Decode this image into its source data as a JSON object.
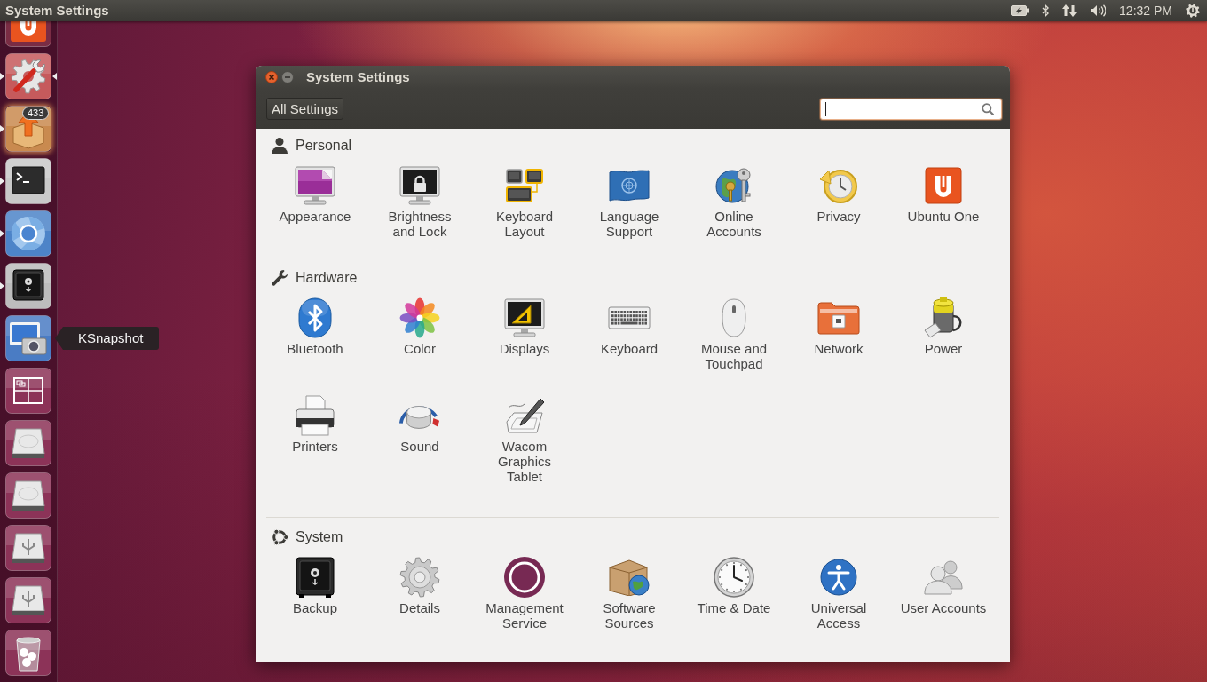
{
  "top_panel": {
    "title": "System Settings",
    "clock": "12:32 PM"
  },
  "launcher": {
    "items": [
      {
        "running": false,
        "focused": false
      },
      {
        "running": true,
        "focused": true
      },
      {
        "running": true,
        "focused": false,
        "badge": "433"
      },
      {
        "running": true,
        "focused": false
      },
      {
        "running": true,
        "focused": false
      },
      {
        "running": true,
        "focused": false
      },
      {
        "running": false,
        "focused": false,
        "tooltip": "KSnapshot"
      },
      {
        "running": false,
        "focused": false
      },
      {
        "running": false,
        "focused": false
      },
      {
        "running": false,
        "focused": false
      },
      {
        "running": false,
        "focused": false
      },
      {
        "running": false,
        "focused": false
      },
      {
        "running": false,
        "focused": false
      }
    ]
  },
  "window": {
    "title": "System Settings",
    "back_button": "All Settings",
    "search": {
      "focused": true
    }
  },
  "sections": [
    {
      "title": "Personal",
      "items": [
        {
          "label": "Appearance"
        },
        {
          "label": "Brightness and Lock"
        },
        {
          "label": "Keyboard Layout"
        },
        {
          "label": "Language Support"
        },
        {
          "label": "Online Accounts"
        },
        {
          "label": "Privacy"
        },
        {
          "label": "Ubuntu One"
        }
      ]
    },
    {
      "title": "Hardware",
      "items": [
        {
          "label": "Bluetooth"
        },
        {
          "label": "Color"
        },
        {
          "label": "Displays"
        },
        {
          "label": "Keyboard"
        },
        {
          "label": "Mouse and Touchpad"
        },
        {
          "label": "Network"
        },
        {
          "label": "Power"
        },
        {
          "label": "Printers"
        },
        {
          "label": "Sound"
        },
        {
          "label": "Wacom Graphics Tablet"
        }
      ]
    },
    {
      "title": "System",
      "items": [
        {
          "label": "Backup"
        },
        {
          "label": "Details"
        },
        {
          "label": "Management Service"
        },
        {
          "label": "Software Sources"
        },
        {
          "label": "Time & Date"
        },
        {
          "label": "Universal Access"
        },
        {
          "label": "User Accounts"
        }
      ]
    }
  ]
}
